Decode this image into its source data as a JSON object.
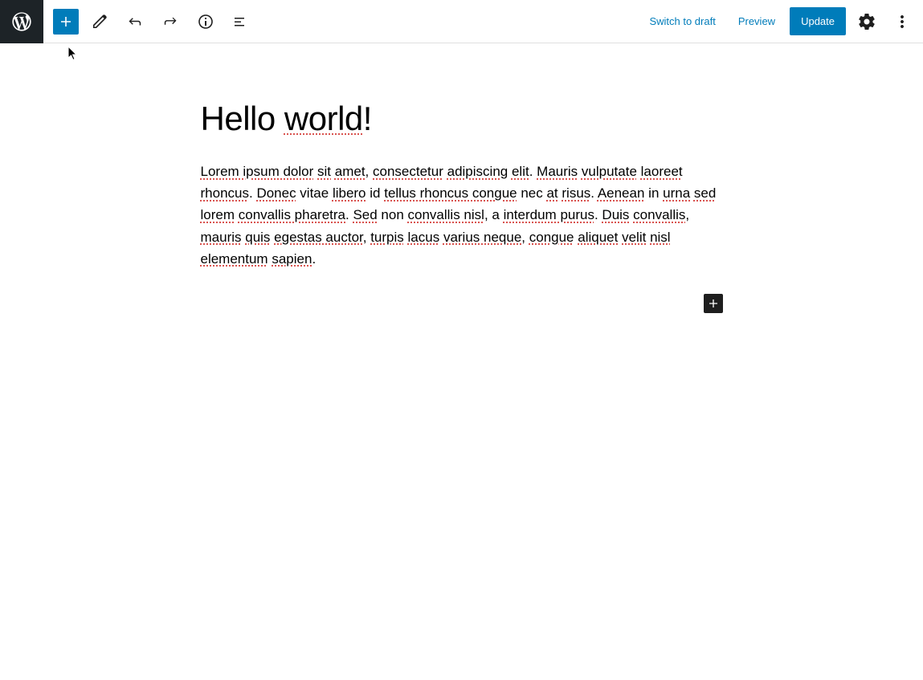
{
  "toolbar": {
    "switch_to_draft": "Switch to draft",
    "preview": "Preview",
    "update": "Update"
  },
  "post": {
    "title_parts": [
      {
        "text": "Hello ",
        "spell": false
      },
      {
        "text": "world",
        "spell": true
      },
      {
        "text": "!",
        "spell": false
      }
    ],
    "paragraph_parts": [
      {
        "text": "Lorem ipsum dolor",
        "spell": true
      },
      {
        "text": " ",
        "spell": false
      },
      {
        "text": "sit",
        "spell": true
      },
      {
        "text": " ",
        "spell": false
      },
      {
        "text": "amet",
        "spell": true
      },
      {
        "text": ", ",
        "spell": false
      },
      {
        "text": "consectetur",
        "spell": true
      },
      {
        "text": " ",
        "spell": false
      },
      {
        "text": "adipiscing",
        "spell": true
      },
      {
        "text": " ",
        "spell": false
      },
      {
        "text": "elit",
        "spell": true
      },
      {
        "text": ". ",
        "spell": false
      },
      {
        "text": "Mauris",
        "spell": true
      },
      {
        "text": " ",
        "spell": false
      },
      {
        "text": "vulputate",
        "spell": true
      },
      {
        "text": " ",
        "spell": false
      },
      {
        "text": "laoreet rhoncus",
        "spell": true
      },
      {
        "text": ". ",
        "spell": false
      },
      {
        "text": "Donec",
        "spell": true
      },
      {
        "text": " vitae ",
        "spell": false
      },
      {
        "text": "libero",
        "spell": true
      },
      {
        "text": " id ",
        "spell": false
      },
      {
        "text": "tellus rhoncus congue",
        "spell": true
      },
      {
        "text": " nec ",
        "spell": false
      },
      {
        "text": "at",
        "spell": true
      },
      {
        "text": " ",
        "spell": false
      },
      {
        "text": "risus",
        "spell": true
      },
      {
        "text": ". ",
        "spell": false
      },
      {
        "text": "Aenean",
        "spell": true
      },
      {
        "text": " in ",
        "spell": false
      },
      {
        "text": "urna",
        "spell": true
      },
      {
        "text": " ",
        "spell": false
      },
      {
        "text": "sed lorem",
        "spell": true
      },
      {
        "text": " ",
        "spell": false
      },
      {
        "text": "convallis pharetra",
        "spell": true
      },
      {
        "text": ". ",
        "spell": false
      },
      {
        "text": "Sed",
        "spell": true
      },
      {
        "text": " non ",
        "spell": false
      },
      {
        "text": "convallis nisl",
        "spell": true
      },
      {
        "text": ", a ",
        "spell": false
      },
      {
        "text": "interdum purus",
        "spell": true
      },
      {
        "text": ". ",
        "spell": false
      },
      {
        "text": "Duis",
        "spell": true
      },
      {
        "text": " ",
        "spell": false
      },
      {
        "text": "convallis",
        "spell": true
      },
      {
        "text": ", ",
        "spell": false
      },
      {
        "text": "mauris",
        "spell": true
      },
      {
        "text": " ",
        "spell": false
      },
      {
        "text": "quis",
        "spell": true
      },
      {
        "text": " ",
        "spell": false
      },
      {
        "text": "egestas auctor",
        "spell": true
      },
      {
        "text": ", ",
        "spell": false
      },
      {
        "text": "turpis",
        "spell": true
      },
      {
        "text": " ",
        "spell": false
      },
      {
        "text": "lacus",
        "spell": true
      },
      {
        "text": " ",
        "spell": false
      },
      {
        "text": "varius neque",
        "spell": true
      },
      {
        "text": ", ",
        "spell": false
      },
      {
        "text": "congue",
        "spell": true
      },
      {
        "text": " ",
        "spell": false
      },
      {
        "text": "aliquet",
        "spell": true
      },
      {
        "text": " ",
        "spell": false
      },
      {
        "text": "velit",
        "spell": true
      },
      {
        "text": " ",
        "spell": false
      },
      {
        "text": "nisl elementum",
        "spell": true
      },
      {
        "text": " ",
        "spell": false
      },
      {
        "text": "sapien",
        "spell": true
      },
      {
        "text": ".",
        "spell": false
      }
    ]
  }
}
